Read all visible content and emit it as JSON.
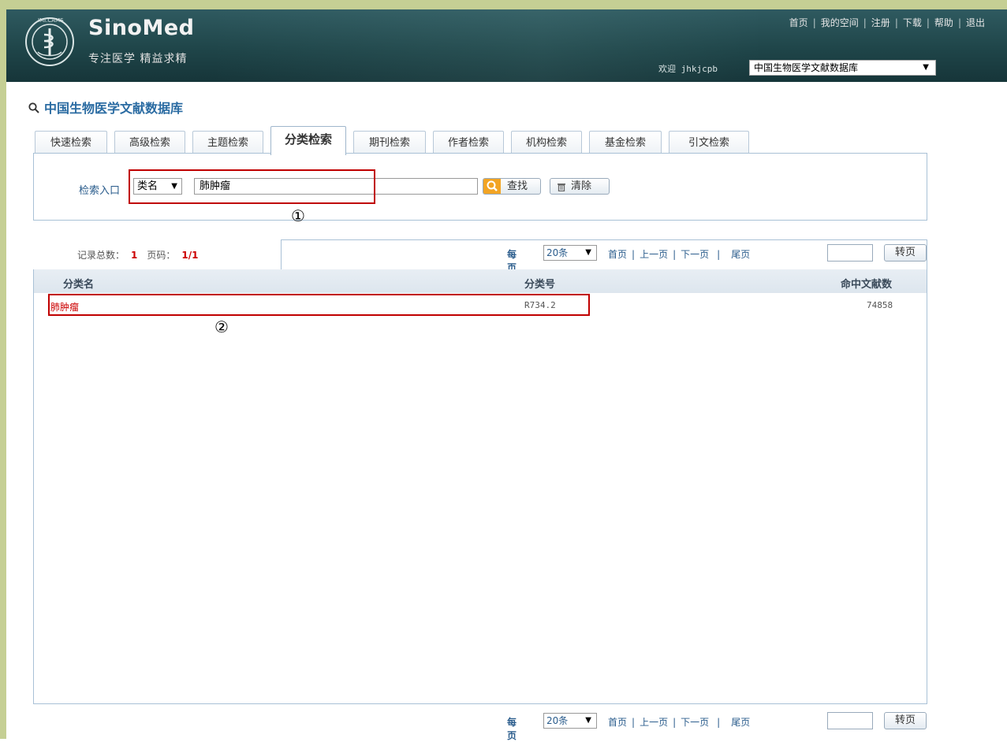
{
  "header": {
    "brand_name": "SinoMed",
    "slogan": "专注医学 精益求精",
    "emblem_text": "IMI.CAMS",
    "top_links": [
      "首页",
      "我的空间",
      "注册",
      "下载",
      "帮助",
      "退出"
    ],
    "welcome": "欢迎 jhkjcpb",
    "database_select": "中国生物医学文献数据库",
    "colors": {
      "header_bg": "#1f4549",
      "frame": "#c5cf94"
    }
  },
  "page": {
    "title": "中国生物医学文献数据库"
  },
  "tabs": [
    {
      "label": "快速检索",
      "active": false
    },
    {
      "label": "高级检索",
      "active": false
    },
    {
      "label": "主题检索",
      "active": false
    },
    {
      "label": "分类检索",
      "active": true
    },
    {
      "label": "期刊检索",
      "active": false
    },
    {
      "label": "作者检索",
      "active": false
    },
    {
      "label": "机构检索",
      "active": false
    },
    {
      "label": "基金检索",
      "active": false
    },
    {
      "label": "引文检索",
      "active": false
    }
  ],
  "search": {
    "entry_label": "检索入口",
    "field_select": "类名",
    "query": "肺肿瘤",
    "find_button": "查找",
    "clear_button": "清除"
  },
  "annotations": {
    "marker1": "①",
    "marker2": "②"
  },
  "results": {
    "total_label": "记录总数：",
    "total_value": "1",
    "page_label": "页码：",
    "page_value": "1/1",
    "columns": [
      "分类名",
      "分类号",
      "命中文献数"
    ],
    "rows": [
      {
        "name": "肺肿瘤",
        "code": "R734.2",
        "count": "74858"
      }
    ]
  },
  "pager": {
    "per_page_label": "每页",
    "per_page_value": "20条",
    "first": "首页",
    "prev": "上一页",
    "next": "下一页",
    "last": "尾页",
    "jump_button": "转页"
  }
}
